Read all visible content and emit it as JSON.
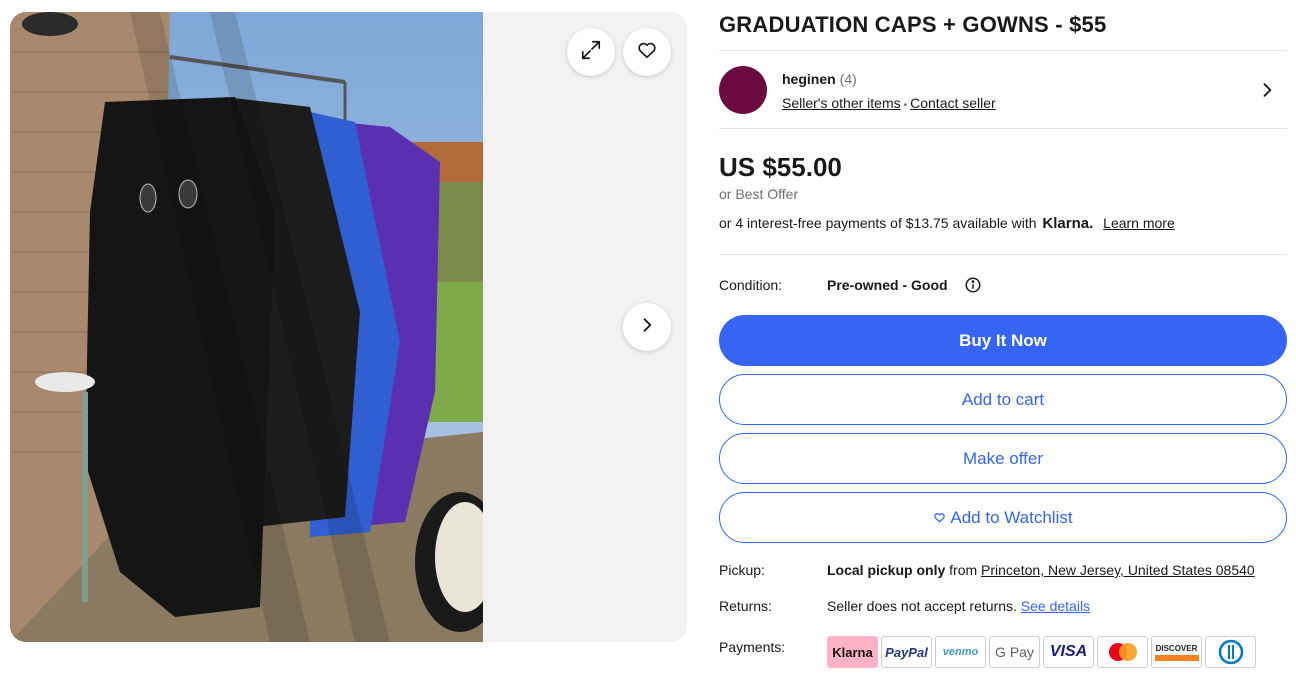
{
  "gallery": {
    "expand_icon": "expand-icon",
    "favorite_icon": "heart-icon",
    "next_icon": "chevron-right-icon"
  },
  "listing": {
    "title": "GRADUATION CAPS + GOWNS - $55"
  },
  "seller": {
    "name": "heginen",
    "feedback_count": "(4)",
    "other_items_label": "Seller's other items",
    "separator": "•",
    "contact_label": "Contact seller",
    "avatar_color": "#6b0a3f"
  },
  "price": {
    "amount": "US $55.00",
    "best_offer": "or Best Offer",
    "installments_prefix": "or 4 interest-free payments of $13.75 available with",
    "installments_brand": "Klarna.",
    "learn_more": "Learn more"
  },
  "condition": {
    "label": "Condition:",
    "value": "Pre-owned - Good"
  },
  "actions": {
    "buy_now": "Buy It Now",
    "add_to_cart": "Add to cart",
    "make_offer": "Make offer",
    "add_to_watchlist": "Add to Watchlist"
  },
  "pickup": {
    "label": "Pickup:",
    "value_bold": "Local pickup only",
    "value_from": "from",
    "location": "Princeton, New Jersey, United States 08540"
  },
  "returns": {
    "label": "Returns:",
    "value": "Seller does not accept returns.",
    "link": "See details"
  },
  "payments": {
    "label": "Payments:",
    "methods": [
      "Klarna",
      "PayPal",
      "venmo",
      "G Pay",
      "VISA",
      "Mastercard",
      "DISCOVER",
      "Diners Club"
    ]
  },
  "colors": {
    "accent": "#3665f3",
    "text": "#191919",
    "muted": "#707070"
  }
}
